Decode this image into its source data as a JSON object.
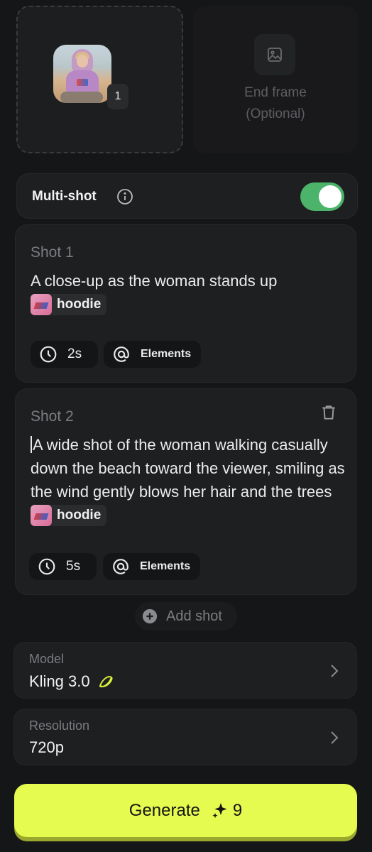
{
  "start_frame": {
    "thumbnail": "woman-hoodie-beach",
    "count": "1"
  },
  "end_frame": {
    "icon": "image-icon",
    "label_line1": "End frame",
    "label_line2": "(Optional)"
  },
  "multishot": {
    "label": "Multi-shot",
    "enabled": true,
    "accent": "#4cb36b"
  },
  "shots": [
    {
      "title": "Shot 1",
      "text": "A close-up as the woman stands up",
      "tag": "hoodie",
      "duration": "2s",
      "elements_label": "Elements"
    },
    {
      "title": "Shot 2",
      "text": "A wide shot of the woman walking casually down the beach toward the viewer, smiling as the wind gently blows her hair and the trees",
      "tag": "hoodie",
      "duration": "5s",
      "elements_label": "Elements"
    }
  ],
  "add_shot": {
    "label": "Add shot"
  },
  "model": {
    "label": "Model",
    "value": "Kling 3.0"
  },
  "resolution": {
    "label": "Resolution",
    "value": "720p"
  },
  "generate": {
    "label": "Generate",
    "credits": "9",
    "accent": "#e6fb4f"
  }
}
